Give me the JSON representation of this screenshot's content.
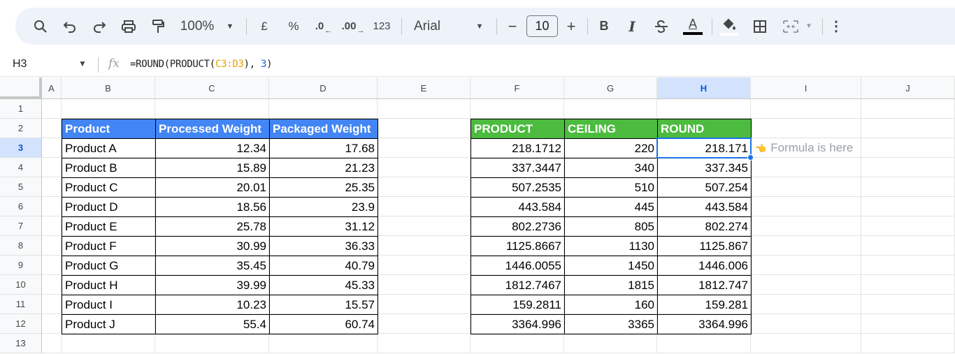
{
  "toolbar": {
    "zoom": "100%",
    "currency": "£",
    "percent": "%",
    "decrease_decimal": ".0",
    "increase_decimal": ".00",
    "number_format": "123",
    "font": "Arial",
    "font_size": "10",
    "bold": "B",
    "italic": "I",
    "text_color_letter": "A"
  },
  "formula_bar": {
    "cell_ref": "H3",
    "fx": "fx",
    "formula_prefix": "=ROUND(PRODUCT(",
    "formula_ref": "C3:D3",
    "formula_mid": "), ",
    "formula_num": "3",
    "formula_suffix": ")"
  },
  "columns": [
    "A",
    "B",
    "C",
    "D",
    "E",
    "F",
    "G",
    "H",
    "I",
    "J"
  ],
  "rows": [
    "1",
    "2",
    "3",
    "4",
    "5",
    "6",
    "7",
    "8",
    "9",
    "10",
    "11",
    "12",
    "13"
  ],
  "selected_cell": {
    "column": "H",
    "row": "3"
  },
  "table_left": {
    "headers": [
      "Product",
      "Processed Weight",
      "Packaged Weight"
    ],
    "rows": [
      [
        "Product A",
        "12.34",
        "17.68"
      ],
      [
        "Product B",
        "15.89",
        "21.23"
      ],
      [
        "Product C",
        "20.01",
        "25.35"
      ],
      [
        "Product D",
        "18.56",
        "23.9"
      ],
      [
        "Product E",
        "25.78",
        "31.12"
      ],
      [
        "Product F",
        "30.99",
        "36.33"
      ],
      [
        "Product G",
        "35.45",
        "40.79"
      ],
      [
        "Product H",
        "39.99",
        "45.33"
      ],
      [
        "Product I",
        "10.23",
        "15.57"
      ],
      [
        "Product J",
        "55.4",
        "60.74"
      ]
    ]
  },
  "table_right": {
    "headers": [
      "PRODUCT",
      "CEILING",
      "ROUND"
    ],
    "rows": [
      [
        "218.1712",
        "220",
        "218.171"
      ],
      [
        "337.3447",
        "340",
        "337.345"
      ],
      [
        "507.2535",
        "510",
        "507.254"
      ],
      [
        "443.584",
        "445",
        "443.584"
      ],
      [
        "802.2736",
        "805",
        "802.274"
      ],
      [
        "1125.8667",
        "1130",
        "1125.867"
      ],
      [
        "1446.0055",
        "1450",
        "1446.006"
      ],
      [
        "1812.7467",
        "1815",
        "1812.747"
      ],
      [
        "159.2811",
        "160",
        "159.281"
      ],
      [
        "3364.996",
        "3365",
        "3364.996"
      ]
    ]
  },
  "annotation": {
    "emoji": "👈",
    "text": "Formula is here"
  },
  "colors": {
    "header_blue": "#4285f4",
    "header_green": "#4cbb3f",
    "selection": "#1a73e8"
  }
}
